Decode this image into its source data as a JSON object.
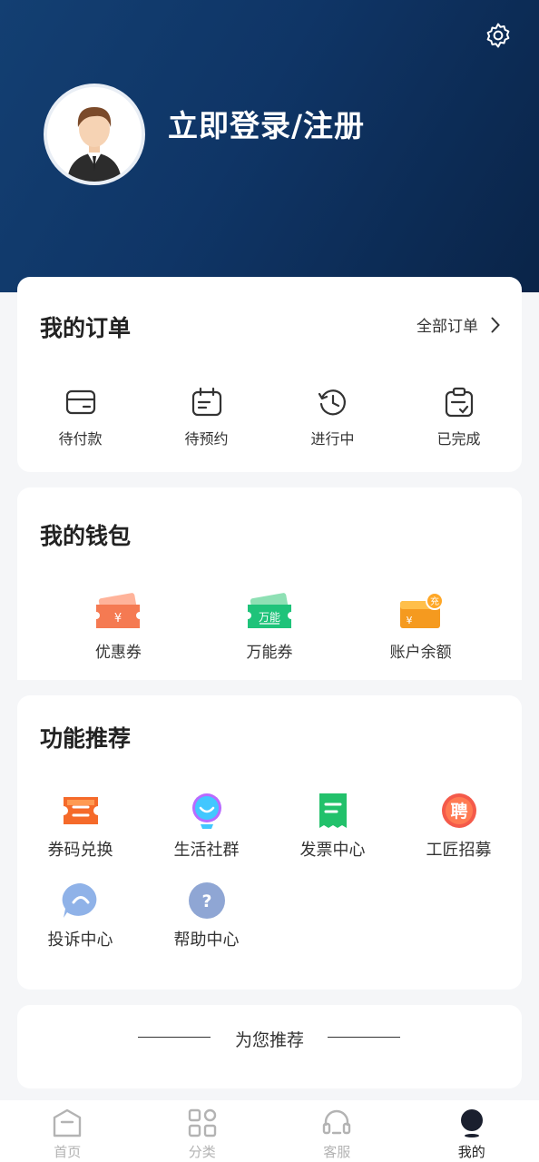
{
  "header": {
    "login_text": "立即登录/注册",
    "settings_icon": "gear-icon",
    "avatar_icon": "user-avatar-icon"
  },
  "orders": {
    "title": "我的订单",
    "all_label": "全部订单",
    "items": [
      {
        "label": "待付款",
        "icon": "wallet-card-icon"
      },
      {
        "label": "待预约",
        "icon": "calendar-icon"
      },
      {
        "label": "进行中",
        "icon": "clock-history-icon"
      },
      {
        "label": "已完成",
        "icon": "clipboard-check-icon"
      }
    ]
  },
  "wallet": {
    "title": "我的钱包",
    "items": [
      {
        "label": "优惠券",
        "icon": "coupon-icon",
        "glyph": "¥"
      },
      {
        "label": "万能券",
        "icon": "universal-coupon-icon",
        "glyph": "万能"
      },
      {
        "label": "账户余额",
        "icon": "balance-wallet-icon",
        "glyph": "¥",
        "badge": "充"
      }
    ]
  },
  "features": {
    "title": "功能推荐",
    "items": [
      {
        "label": "券码兑换",
        "icon": "ticket-exchange-icon"
      },
      {
        "label": "生活社群",
        "icon": "community-icon"
      },
      {
        "label": "发票中心",
        "icon": "invoice-icon"
      },
      {
        "label": "工匠招募",
        "icon": "recruit-icon",
        "glyph": "聘"
      },
      {
        "label": "投诉中心",
        "icon": "complaint-icon"
      },
      {
        "label": "帮助中心",
        "icon": "help-icon",
        "glyph": "?"
      }
    ]
  },
  "recommend": {
    "label": "为您推荐"
  },
  "tabbar": {
    "items": [
      {
        "label": "首页",
        "icon": "home-icon"
      },
      {
        "label": "分类",
        "icon": "grid-icon"
      },
      {
        "label": "客服",
        "icon": "headset-icon"
      },
      {
        "label": "我的",
        "icon": "profile-icon"
      }
    ],
    "active": "我的"
  },
  "colors": {
    "header_gradient_start": "#133f72",
    "header_gradient_end": "#0a2448",
    "background": "#f5f6f8",
    "tab_inactive": "#b3b3b3"
  }
}
